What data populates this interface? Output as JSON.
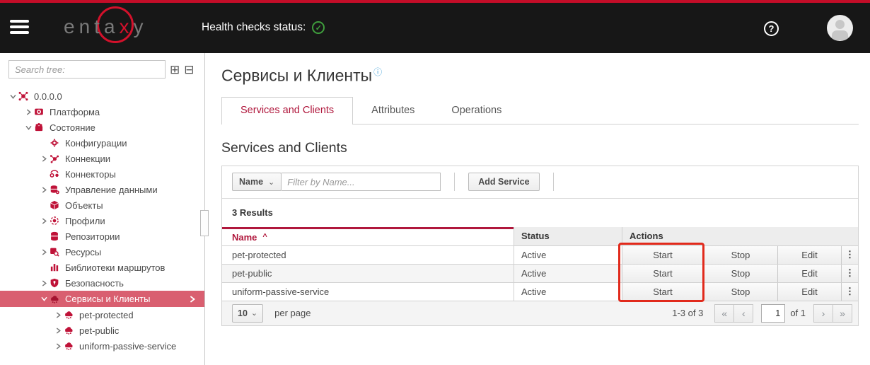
{
  "colors": {
    "accent_crimson": "#b0173c",
    "topbar_red": "#c30d28",
    "selected_tree_row": "#d95f70",
    "status_green": "#3f9e3d",
    "annotation_red": "#e12a1c",
    "info_blue": "#3f9fd8",
    "tree_icon_red": "#bf1238"
  },
  "icons": {
    "check": "✓",
    "help": "?",
    "info": "ⓘ",
    "kebab": "⋮",
    "caret": "⌄",
    "expand_all": "⊞",
    "collapse_all": "⊟",
    "sort_asc": "^",
    "first": "«",
    "prev": "‹",
    "next": "›",
    "last": "»"
  },
  "header": {
    "logo": {
      "left": "ent",
      "mid_a": "a",
      "mid_x": "x",
      "right": "y"
    },
    "health_label": "Health checks status:",
    "health_state": "ok"
  },
  "sidebar": {
    "search_placeholder": "Search tree:",
    "tree": [
      {
        "label": "0.0.0.0",
        "level": 0,
        "state": "expanded",
        "icon": "network-node-icon",
        "selected": false
      },
      {
        "label": "Платформа",
        "level": 1,
        "state": "collapsed",
        "icon": "platform-icon",
        "selected": false
      },
      {
        "label": "Состояние",
        "level": 1,
        "state": "expanded",
        "icon": "state-icon",
        "selected": false
      },
      {
        "label": "Конфигурации",
        "level": 2,
        "state": "leaf",
        "icon": "configurations-icon",
        "selected": false
      },
      {
        "label": "Коннекции",
        "level": 2,
        "state": "collapsed",
        "icon": "connections-icon",
        "selected": false
      },
      {
        "label": "Коннекторы",
        "level": 2,
        "state": "leaf",
        "icon": "connectors-icon",
        "selected": false
      },
      {
        "label": "Управление данными",
        "level": 2,
        "state": "collapsed",
        "icon": "data-management-icon",
        "selected": false
      },
      {
        "label": "Объекты",
        "level": 2,
        "state": "leaf",
        "icon": "objects-icon",
        "selected": false
      },
      {
        "label": "Профили",
        "level": 2,
        "state": "collapsed",
        "icon": "profiles-icon",
        "selected": false
      },
      {
        "label": "Репозитории",
        "level": 2,
        "state": "leaf",
        "icon": "repositories-icon",
        "selected": false
      },
      {
        "label": "Ресурсы",
        "level": 2,
        "state": "collapsed",
        "icon": "resources-icon",
        "selected": false
      },
      {
        "label": "Библиотеки маршрутов",
        "level": 2,
        "state": "leaf",
        "icon": "route-libraries-icon",
        "selected": false
      },
      {
        "label": "Безопасность",
        "level": 2,
        "state": "collapsed",
        "icon": "security-icon",
        "selected": false
      },
      {
        "label": "Сервисы и Клиенты",
        "level": 2,
        "state": "expanded",
        "icon": "services-icon",
        "selected": true
      },
      {
        "label": "pet-protected",
        "level": 3,
        "state": "collapsed",
        "icon": "service-icon",
        "selected": false
      },
      {
        "label": "pet-public",
        "level": 3,
        "state": "collapsed",
        "icon": "service-icon",
        "selected": false
      },
      {
        "label": "uniform-passive-service",
        "level": 3,
        "state": "collapsed",
        "icon": "service-icon",
        "selected": false
      }
    ]
  },
  "main": {
    "page_title": "Сервисы и Клиенты",
    "tabs": [
      {
        "label": "Services and Clients",
        "active": true
      },
      {
        "label": "Attributes",
        "active": false
      },
      {
        "label": "Operations",
        "active": false
      }
    ],
    "section_title": "Services and Clients",
    "toolbar": {
      "filter_field": "Name",
      "filter_placeholder": "Filter by Name...",
      "add_button": "Add Service"
    },
    "results_count": "3 Results",
    "table": {
      "columns": [
        "Name",
        "Status",
        "Actions"
      ],
      "sort": {
        "column": "Name",
        "direction": "asc",
        "glyph": "^"
      },
      "rows": [
        {
          "name": "pet-protected",
          "status": "Active",
          "actions": [
            "Start",
            "Stop",
            "Edit"
          ]
        },
        {
          "name": "pet-public",
          "status": "Active",
          "actions": [
            "Start",
            "Stop",
            "Edit"
          ]
        },
        {
          "name": "uniform-passive-service",
          "status": "Active",
          "actions": [
            "Start",
            "Stop",
            "Edit"
          ]
        }
      ]
    },
    "pagination": {
      "page_size": "10",
      "per_page_label": "per page",
      "range": "1-3 of 3",
      "page": "1",
      "of_label": "of 1"
    },
    "annotation": {
      "target": "Start action column",
      "color": "#e12a1c"
    }
  }
}
